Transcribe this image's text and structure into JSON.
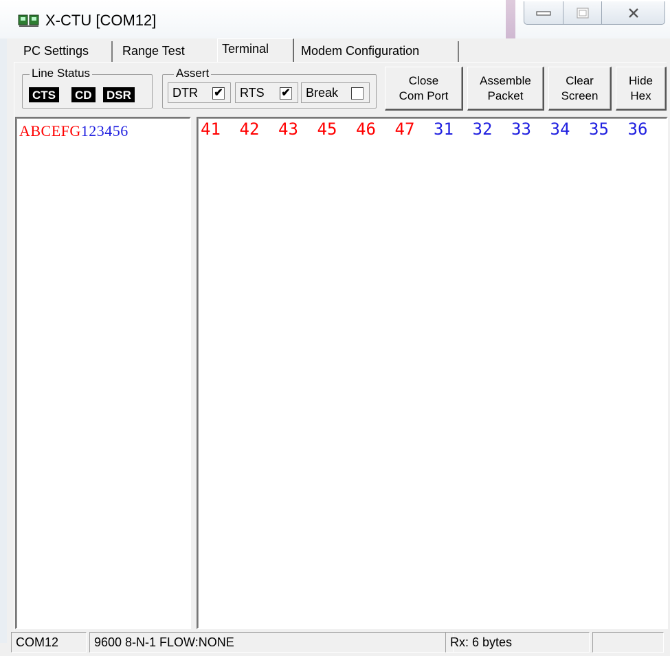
{
  "window": {
    "title": "X-CTU  [COM12]"
  },
  "tabs": [
    {
      "label": "PC Settings"
    },
    {
      "label": "Range Test"
    },
    {
      "label": "Terminal"
    },
    {
      "label": "Modem Configuration"
    }
  ],
  "line_status": {
    "label": "Line Status",
    "indicators": [
      "CTS",
      "CD",
      "DSR"
    ]
  },
  "assert": {
    "label": "Assert",
    "items": [
      {
        "label": "DTR",
        "checked": true,
        "mark": "✔"
      },
      {
        "label": "RTS",
        "checked": true,
        "mark": "✔"
      },
      {
        "label": "Break",
        "checked": false,
        "mark": ""
      }
    ]
  },
  "buttons": {
    "close_com_port": [
      "Close",
      "Com Port"
    ],
    "assemble_packet": [
      "Assemble",
      "Packet"
    ],
    "clear_screen": [
      "Clear",
      "Screen"
    ],
    "hide_hex": [
      "Hide",
      "Hex"
    ]
  },
  "terminal": {
    "ascii_sent": "ABCEFG",
    "ascii_received": "123456",
    "hex_sent": [
      "41",
      "42",
      "43",
      "45",
      "46",
      "47"
    ],
    "hex_received": [
      "31",
      "32",
      "33",
      "34",
      "35",
      "36"
    ]
  },
  "statusbar": {
    "port": "COM12",
    "settings": "9600 8-N-1  FLOW:NONE",
    "rx": "Rx: 6 bytes"
  },
  "colors": {
    "sent": "#ff0000",
    "received": "#2020e0"
  }
}
